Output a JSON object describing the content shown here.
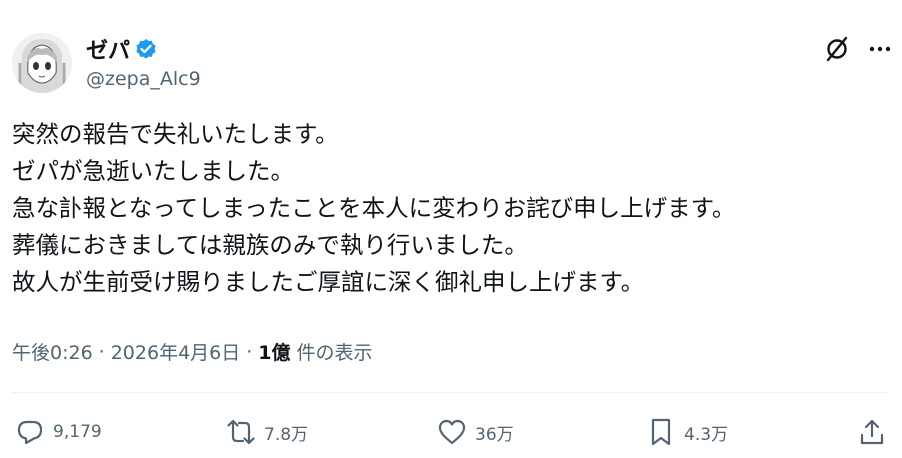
{
  "user": {
    "display_name": "ゼパ",
    "handle": "@zepa_Alc9"
  },
  "tweet": {
    "lines": [
      "突然の報告で失礼いたします。",
      "ゼパが急逝いたしました。",
      "急な訃報となってしまったことを本人に変わりお詫び申し上げます。",
      "葬儀におきましては親族のみで執り行いました。",
      "故人が生前受け賜りましたご厚誼に深く御礼申し上げます。"
    ]
  },
  "meta": {
    "time": "午後0:26",
    "separator": "·",
    "date": "2026年4月6日",
    "views_number": "1億",
    "views_label": "件の表示"
  },
  "actions": {
    "replies": "9,179",
    "reposts": "7.8万",
    "likes": "36万",
    "bookmarks": "4.3万"
  },
  "colors": {
    "text": "#0f1419",
    "secondary": "#536471",
    "verified": "#1d9bf0",
    "divider": "#eff3f4"
  },
  "icons": [
    "verified-badge-icon",
    "grok-icon",
    "more-icon",
    "reply-icon",
    "repost-icon",
    "like-icon",
    "bookmark-icon",
    "share-icon"
  ]
}
